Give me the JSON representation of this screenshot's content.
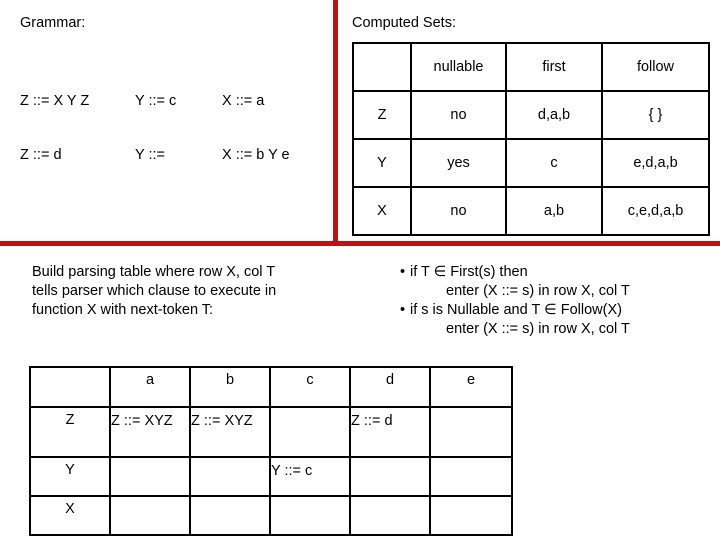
{
  "colors": {
    "rule_red": "#b81414",
    "text": "#000000",
    "background": "#ffffff",
    "border": "#000000"
  },
  "grammar": {
    "label": "Grammar:",
    "rules": [
      {
        "col1": "Z ::= X Y Z",
        "col2": "Y ::= c",
        "col3": "X ::= a"
      },
      {
        "col1": "Z ::= d",
        "col2": "Y ::=",
        "col3": "X ::= b Y e"
      }
    ]
  },
  "computed_sets": {
    "label": "Computed Sets:",
    "headers": [
      "",
      "nullable",
      "first",
      "follow"
    ],
    "rows": [
      {
        "symbol": "Z",
        "nullable": "no",
        "first": "d,a,b",
        "follow": "{ }"
      },
      {
        "symbol": "Y",
        "nullable": "yes",
        "first": "c",
        "follow": "e,d,a,b"
      },
      {
        "symbol": "X",
        "nullable": "no",
        "first": "a,b",
        "follow": "c,e,d,a,b"
      }
    ]
  },
  "instructions": {
    "left": {
      "line1": "Build parsing table where row X, col T",
      "line2": "tells parser which clause to execute in",
      "line3": "function X with next-token T:"
    },
    "right": {
      "bullet1": "if T ∈ First(s) then",
      "bullet1_sub": "enter (X ::= s) in row X, col T",
      "bullet2": "if s is Nullable and T ∈ Follow(X)",
      "bullet2_sub": "enter (X ::= s) in row X, col T",
      "bullet_glyph": "•"
    }
  },
  "parsing_table": {
    "headers": [
      "",
      "a",
      "b",
      "c",
      "d",
      "e"
    ],
    "rows": [
      {
        "symbol": "Z",
        "a": "Z ::= XYZ",
        "b": "Z ::= XYZ",
        "c": "",
        "d": "Z ::= d",
        "e": ""
      },
      {
        "symbol": "Y",
        "a": "",
        "b": "",
        "c": "Y ::= c",
        "d": "",
        "e": ""
      },
      {
        "symbol": "X",
        "a": "",
        "b": "",
        "c": "",
        "d": "",
        "e": ""
      }
    ]
  }
}
